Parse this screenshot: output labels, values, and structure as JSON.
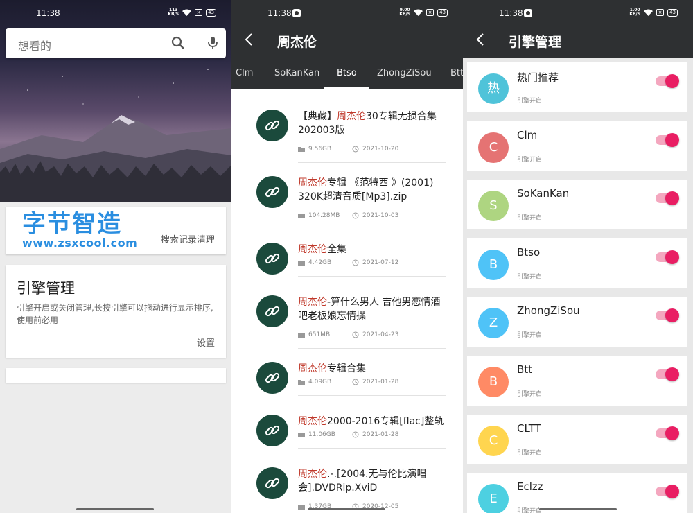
{
  "panel1": {
    "status": {
      "time": "11:38",
      "netspeed_value": "113",
      "netspeed_unit": "KB/S",
      "battery": "43"
    },
    "search": {
      "placeholder": "想看的"
    },
    "logo": {
      "line1": "字节智造",
      "line2": "www.zsxcool.com"
    },
    "clear_history": "搜索记录清理",
    "engine_card": {
      "title": "引擎管理",
      "description": "引擎开启或关闭管理,长按引擎可以拖动进行显示排序,使用前必用",
      "settings": "设置"
    }
  },
  "panel2": {
    "status": {
      "time": "11:38",
      "netspeed_value": "9.00",
      "netspeed_unit": "KB/S",
      "battery": "43"
    },
    "title": "周杰伦",
    "tabs": [
      {
        "label": "Clm"
      },
      {
        "label": "SoKanKan"
      },
      {
        "label": "Btso",
        "active": true
      },
      {
        "label": "ZhongZiSou"
      },
      {
        "label": "Btt"
      }
    ],
    "results": [
      {
        "pre": "【典藏】",
        "hl": "周杰伦",
        "post": "30专辑无损合集202003版",
        "size": "9.56GB",
        "date": "2021-10-20"
      },
      {
        "pre": "",
        "hl": "周杰伦",
        "post": "专辑 《范特西 》(2001) 320K超清音质[Mp3].zip",
        "size": "104.28MB",
        "date": "2021-10-03"
      },
      {
        "pre": "",
        "hl": "周杰伦",
        "post": "全集",
        "size": "4.42GB",
        "date": "2021-07-12"
      },
      {
        "pre": "",
        "hl": "周杰伦",
        "post": "-算什么男人 吉他男恋情酒吧老板娘忘情操",
        "size": "651MB",
        "date": "2021-04-23"
      },
      {
        "pre": "",
        "hl": "周杰伦",
        "post": "专辑合集",
        "size": "4.09GB",
        "date": "2021-01-28"
      },
      {
        "pre": "",
        "hl": "周杰伦",
        "post": "2000-2016专辑[flac]整轨",
        "size": "11.06GB",
        "date": "2021-01-28"
      },
      {
        "pre": "",
        "hl": "周杰伦",
        "post": ".-.[2004.无与伦比演唱会].DVDRip.XviD",
        "size": "1.37GB",
        "date": "2020-12-05"
      }
    ]
  },
  "panel3": {
    "status": {
      "time": "11:38",
      "netspeed_value": "1.00",
      "netspeed_unit": "KB/S",
      "battery": "43"
    },
    "title": "引擎管理",
    "engines": [
      {
        "letter": "热",
        "name": "热门推荐",
        "status": "引擎开启",
        "color": "#4fc3d9",
        "enabled": true
      },
      {
        "letter": "C",
        "name": "Clm",
        "status": "引擎开启",
        "color": "#e57373",
        "enabled": true
      },
      {
        "letter": "S",
        "name": "SoKanKan",
        "status": "引擎开启",
        "color": "#aed581",
        "enabled": true
      },
      {
        "letter": "B",
        "name": "Btso",
        "status": "引擎开启",
        "color": "#4fc3f7",
        "enabled": true
      },
      {
        "letter": "Z",
        "name": "ZhongZiSou",
        "status": "引擎开启",
        "color": "#4fc3f7",
        "enabled": true
      },
      {
        "letter": "B",
        "name": "Btt",
        "status": "引擎开启",
        "color": "#ff8a65",
        "enabled": true
      },
      {
        "letter": "C",
        "name": "CLTT",
        "status": "引擎开启",
        "color": "#ffd54f",
        "enabled": true
      },
      {
        "letter": "E",
        "name": "Eclzz",
        "status": "引擎开启",
        "color": "#4dd0e1",
        "enabled": true
      }
    ]
  }
}
